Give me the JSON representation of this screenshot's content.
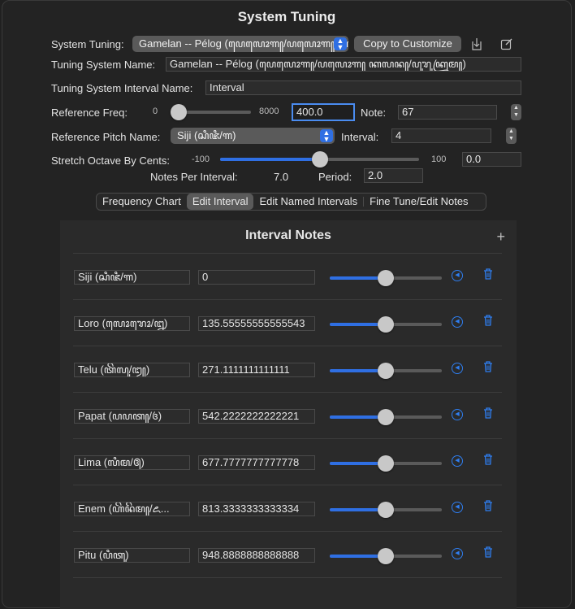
{
  "window": {
    "title": "System Tuning"
  },
  "tuning": {
    "system_label": "System Tuning:",
    "system_value": "Gamelan -- Pélog (ꦥꦺꦭꦺꦴꦒ꧀/ꦥꦭꦺꦴꦒ꧀ ꦏꦭ...",
    "copy_button": "Copy to Customize",
    "name_label": "Tuning System Name:",
    "name_value": "Gamelan -- Pélog (ꦥꦺꦭꦺꦴꦒ꧀/ꦥꦭꦺꦴꦒ꧀ ꦏꦭꦤ꧀/ꦥꦸꦫꦸꦏꦿꦸꦩ꧀)",
    "interval_name_label": "Tuning System Interval Name:",
    "interval_name_value": "Interval",
    "ref_freq_label": "Reference Freq:",
    "ref_freq_min": "0",
    "ref_freq_max": "8000",
    "ref_freq_value": "400.0",
    "ref_freq_fraction": 0.05,
    "note_label": "Note:",
    "note_value": "67",
    "ref_pitch_label": "Reference Pitch Name:",
    "ref_pitch_value": "Siji (ꦱꦶꦗꦶ/꧑)",
    "interval_label": "Interval:",
    "interval_value": "4",
    "stretch_label": "Stretch Octave By Cents:",
    "stretch_min": "-100",
    "stretch_max": "100",
    "stretch_value": "0.0",
    "stretch_fraction": 0.5,
    "notes_per_interval_label": "Notes Per Interval:",
    "notes_per_interval_value": "7.0",
    "period_label": "Period:",
    "period_value": "2.0"
  },
  "tabs": [
    {
      "label": "Frequency Chart"
    },
    {
      "label": "Edit Interval",
      "selected": true
    },
    {
      "label": "Edit Named Intervals"
    },
    {
      "label": "Fine Tune/Edit Notes"
    }
  ],
  "interval_notes": {
    "title": "Interval Notes",
    "add_label": "+",
    "rows": [
      {
        "name": "Siji (ꦱꦶꦗꦶ/꧑)",
        "cents": "0",
        "level": 0.5
      },
      {
        "name": "Loro (ꦭꦺꦴꦫꦺꦴ/꧒)",
        "cents": "135.55555555555543",
        "level": 0.5
      },
      {
        "name": "Telu (ꦠꦼꦭꦸ/꧓)",
        "cents": "271.1111111111111",
        "level": 0.5
      },
      {
        "name": "Papat (ꦥꦥꦠ꧀/꧔)",
        "cents": "542.2222222222221",
        "level": 0.5
      },
      {
        "name": "Lima (ꦭꦶꦩ/꧕)",
        "cents": "677.7777777777778",
        "level": 0.5
      },
      {
        "name": "Enem (ꦲꦼꦤꦼꦩ꧀/꧖...",
        "cents": "813.3333333333334",
        "level": 0.5
      },
      {
        "name": "Pitu (ꦥꦶꦠꦸ)",
        "cents": "948.8888888888888",
        "level": 0.5
      }
    ]
  },
  "colors": {
    "accent": "#2f6fe3",
    "background": "#232323"
  },
  "icons": {
    "export": "export-icon",
    "edit": "edit-icon",
    "play": "play-icon",
    "trash": "trash-icon"
  }
}
